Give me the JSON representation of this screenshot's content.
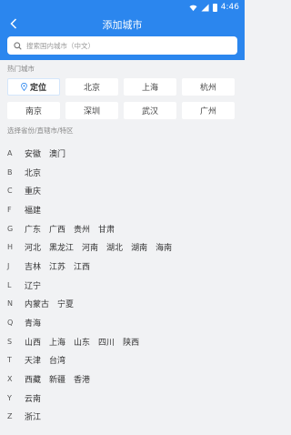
{
  "status": {
    "time": "4:46"
  },
  "header": {
    "title": "添加城市"
  },
  "search": {
    "placeholder": "搜索国内城市（中文）"
  },
  "hot_section": {
    "title": "热门城市",
    "current_label": "定位",
    "cities": [
      "北京",
      "上海",
      "杭州",
      "南京",
      "深圳",
      "武汉",
      "广州"
    ]
  },
  "province_section": {
    "title": "选择省份/直辖市/特区"
  },
  "groups": [
    {
      "letter": "A",
      "items": [
        "安徽",
        "澳门"
      ]
    },
    {
      "letter": "B",
      "items": [
        "北京"
      ]
    },
    {
      "letter": "C",
      "items": [
        "重庆"
      ]
    },
    {
      "letter": "F",
      "items": [
        "福建"
      ]
    },
    {
      "letter": "G",
      "items": [
        "广东",
        "广西",
        "贵州",
        "甘肃"
      ]
    },
    {
      "letter": "H",
      "items": [
        "河北",
        "黑龙江",
        "河南",
        "湖北",
        "湖南",
        "海南"
      ]
    },
    {
      "letter": "J",
      "items": [
        "吉林",
        "江苏",
        "江西"
      ]
    },
    {
      "letter": "L",
      "items": [
        "辽宁"
      ]
    },
    {
      "letter": "N",
      "items": [
        "内蒙古",
        "宁夏"
      ]
    },
    {
      "letter": "Q",
      "items": [
        "青海"
      ]
    },
    {
      "letter": "S",
      "items": [
        "山西",
        "上海",
        "山东",
        "四川",
        "陕西"
      ]
    },
    {
      "letter": "T",
      "items": [
        "天津",
        "台湾"
      ]
    },
    {
      "letter": "X",
      "items": [
        "西藏",
        "新疆",
        "香港"
      ]
    },
    {
      "letter": "Y",
      "items": [
        "云南"
      ]
    },
    {
      "letter": "Z",
      "items": [
        "浙江"
      ]
    }
  ],
  "colors": {
    "accent": "#2b86ee",
    "background": "#f1f2f4"
  },
  "icons": [
    "back-arrow-icon",
    "search-icon",
    "location-pin-icon",
    "wifi-icon",
    "signal-icon",
    "battery-icon"
  ]
}
